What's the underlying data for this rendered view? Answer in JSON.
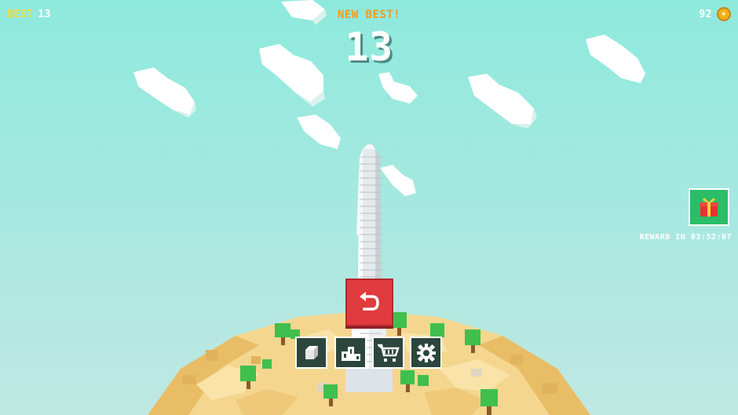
{
  "hud": {
    "best_label": "BEST",
    "best_value": "13",
    "new_best_label": "NEW BEST!",
    "score": "13",
    "coins": "92",
    "coin_icon": "star-coin-icon"
  },
  "reward": {
    "label": "REWARD IN 03:52:07",
    "icon": "gift-icon"
  },
  "buttons": {
    "restart_icon": "restart-arrow-icon",
    "menu": [
      {
        "name": "skins-button",
        "icon": "cube-icon"
      },
      {
        "name": "leaderboard-button",
        "icon": "podium-icon"
      },
      {
        "name": "shop-button",
        "icon": "cart-icon"
      },
      {
        "name": "settings-button",
        "icon": "gear-icon"
      }
    ]
  },
  "colors": {
    "sky_top": "#8ee8dc",
    "sky_bottom": "#bbe7e1",
    "best_label": "#f6dd3a",
    "new_best": "#f39a1e",
    "restart": "#e03b3e",
    "gift": "#2bbd68",
    "menu_button": "#2c463e",
    "sand": "#f1d393"
  }
}
